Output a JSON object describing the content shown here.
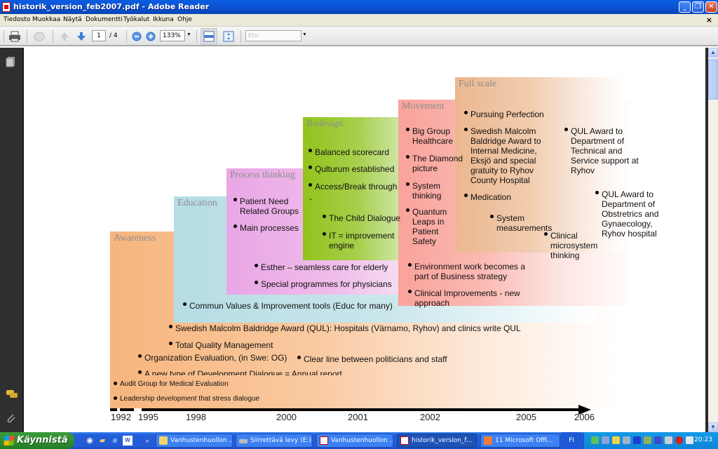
{
  "window": {
    "title": "historik_version_feb2007.pdf - Adobe Reader",
    "controls": {
      "minimize": "_",
      "restore": "❐",
      "close": "✕"
    }
  },
  "menu": {
    "items": [
      "Tiedosto",
      "Muokkaa",
      "Näytä",
      "Dokumentti",
      "Työkalut",
      "Ikkuna",
      "Ohje"
    ],
    "close_doc": "×"
  },
  "toolbar": {
    "page_current": "1",
    "page_total": "/ 4",
    "zoom_value": "133%",
    "search_placeholder": "Etsi"
  },
  "slide": {
    "stages": [
      {
        "title": "Awareness",
        "color": "#f7b57d"
      },
      {
        "title": "Education",
        "color": "#b6dde4"
      },
      {
        "title": "Process thinking",
        "color": "#e9a6e6"
      },
      {
        "title": "Redesign",
        "color": "#92c31c"
      },
      {
        "title": "Movement",
        "color": "#f9a29b"
      },
      {
        "title": "Full scale",
        "color": "#ebb78f"
      }
    ],
    "items": {
      "process_thinking": [
        "Patient Need Related Groups",
        "Main processes",
        "Esther – seamless care for elderly",
        "Special programmes for physicians"
      ],
      "redesign": [
        "Balanced scorecard",
        "Qulturum established",
        "Access/Break through",
        "-",
        "The Child Dialogue",
        "IT = improvement engine"
      ],
      "movement": [
        "Big Group Healthcare",
        "The Diamond picture",
        "System thinking",
        "Quantum Leaps in Patient Safety",
        "Environment work becomes a part of Business strategy",
        "Clinical Improvements - new approach"
      ],
      "full_scale": [
        "Pursuing Perfection",
        "Swedish Malcolm Baldridge Award to Internal Medicine, Eksjö and special gratuity to Ryhov County Hospital",
        "Medication",
        "System measurements",
        "Clinical microsystem thinking",
        "QUL Award to Department of Technical and Service support at Ryhov",
        "QUL Award to Department of Obstretrics and Gynaecology, Ryhov hospital"
      ],
      "education": [
        "Commun Values & Improvement tools (Educ for many)"
      ],
      "awareness": [
        "Swedish Malcolm Baldridge Award (QUL): Hospitals (Värnamo, Ryhov) and clinics write QUL",
        "Total Quality Management",
        "Organization Evaluation, (in Swe: OG)",
        "Clear line between politicians and staff",
        "A new type of Development Dialogue = Annual report",
        "Audit Group for Medical Evaluation",
        "Leadership development that stress dialogue"
      ]
    },
    "years": [
      "1992",
      "1995",
      "1998",
      "2000",
      "2001",
      "2002",
      "2005",
      "2006"
    ]
  },
  "taskbar": {
    "start_label": "Käynnistä",
    "tasks": [
      "Vanhustenhuollon ...",
      "Siirrettävä levy (E:)",
      "Vanhustenhuollon ...",
      "historik_version_f...",
      "11 Microsoft Offi..."
    ],
    "language": "FI",
    "clock": "20:23"
  }
}
